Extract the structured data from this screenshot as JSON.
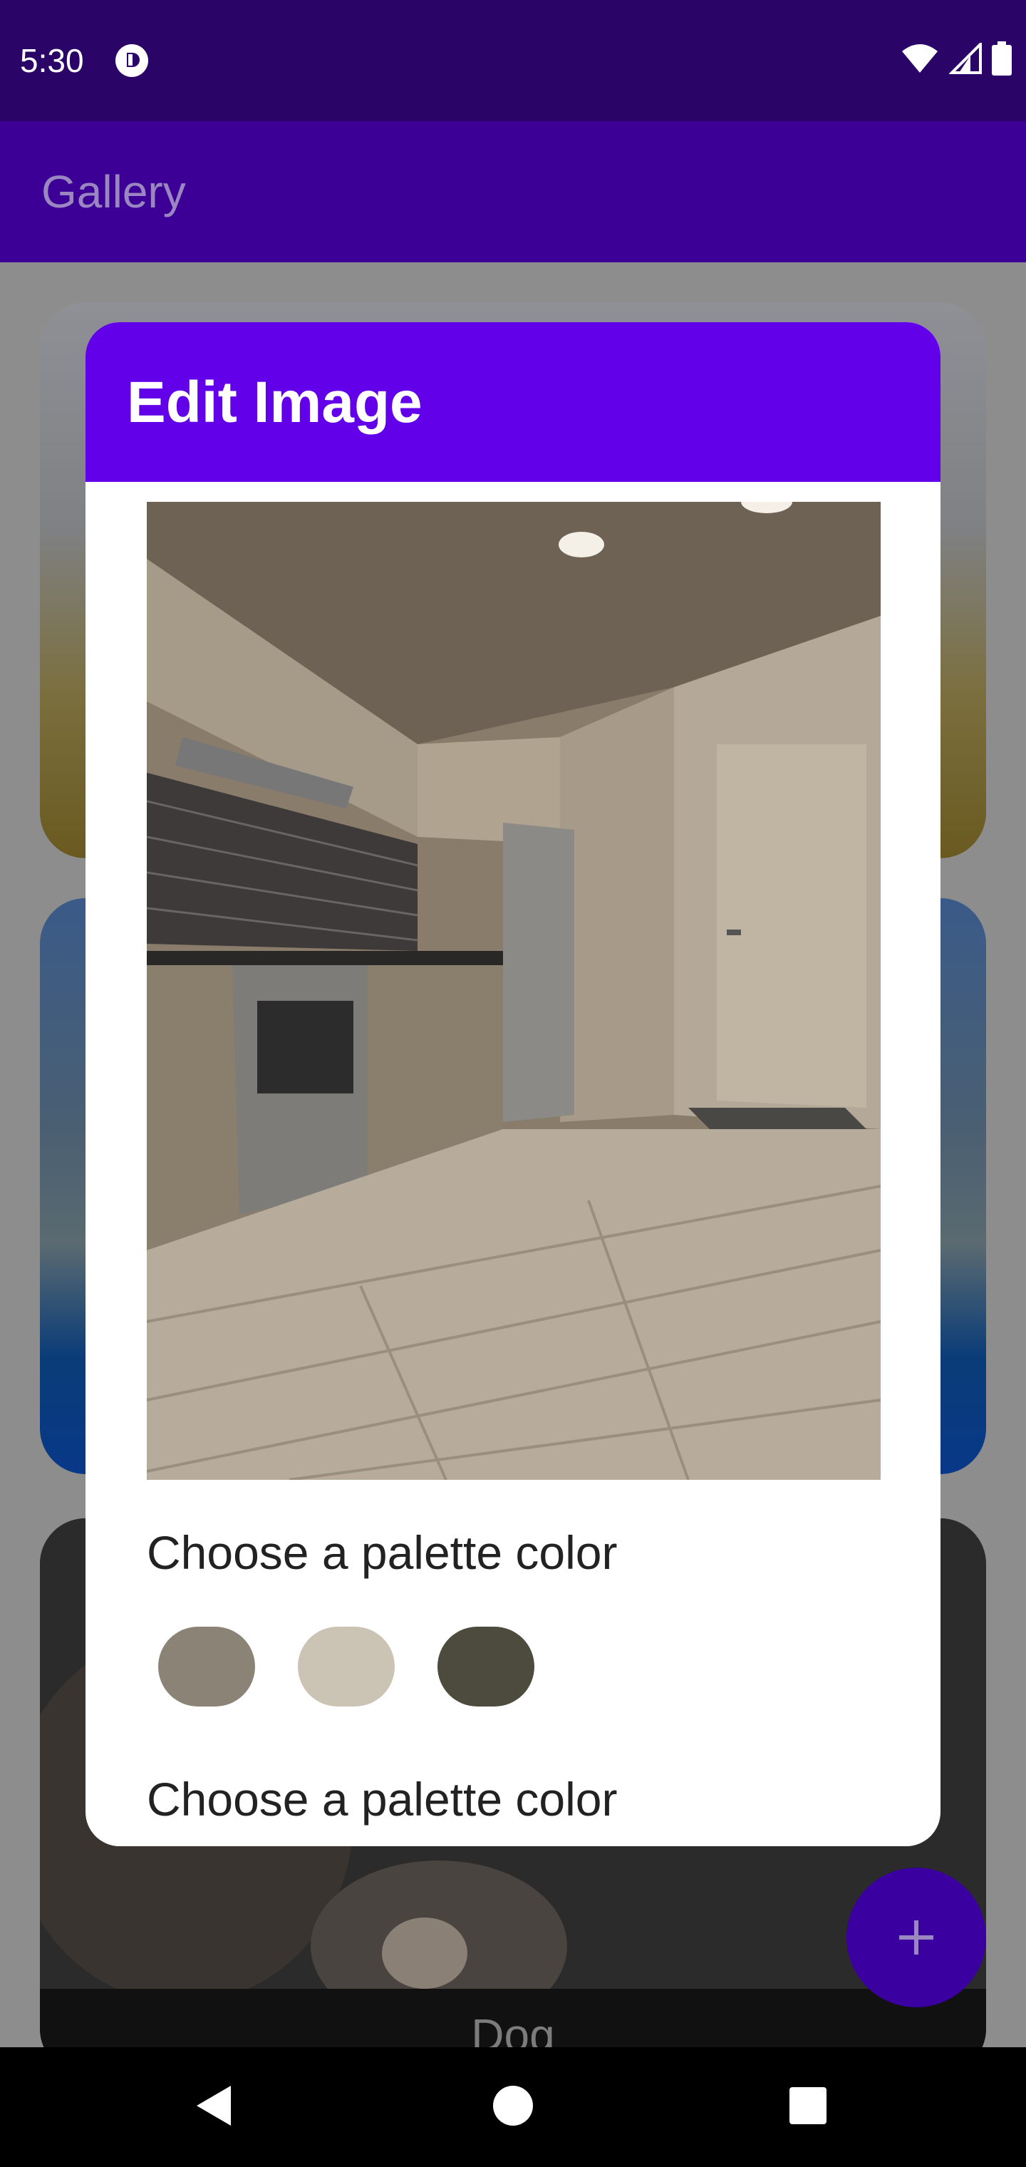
{
  "status_bar": {
    "time": "5:30",
    "icons": [
      "app-notification-icon",
      "wifi-icon",
      "signal-icon",
      "battery-icon"
    ]
  },
  "app_bar": {
    "title": "Gallery"
  },
  "gallery": {
    "cards": [
      {
        "label": ""
      },
      {
        "label": ""
      },
      {
        "label": "Dog"
      }
    ]
  },
  "fab": {
    "icon": "plus-icon",
    "label": "+"
  },
  "dialog": {
    "title": "Edit Image",
    "image_description": "kitchen-photo",
    "palette_section_1": "Choose a palette color",
    "palette_section_2": "Choose a palette color",
    "swatches": [
      "#8b8375",
      "#cbc3b4",
      "#4d4a3e"
    ]
  },
  "nav_bar": {
    "icons": [
      "back-icon",
      "home-icon",
      "recents-icon"
    ]
  },
  "colors": {
    "status_bar": "#2a0466",
    "app_bar": "#3c0096",
    "dialog_header": "#6200ea",
    "fab": "#3a00a0"
  }
}
